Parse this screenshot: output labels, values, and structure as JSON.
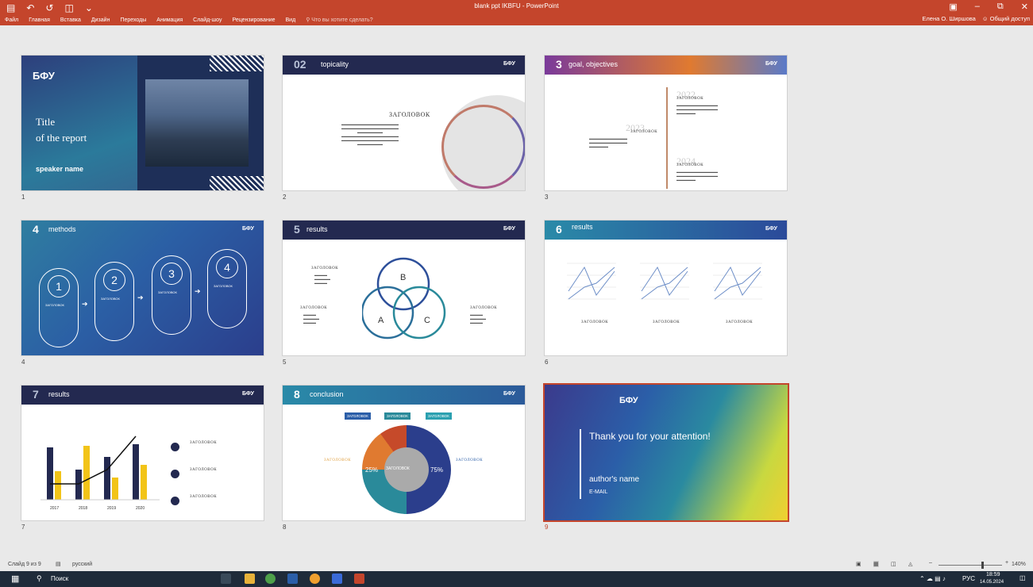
{
  "window": {
    "title": "blank ppt IKBFU - PowerPoint"
  },
  "ribbon": {
    "tabs": [
      "Файл",
      "Главная",
      "Вставка",
      "Дизайн",
      "Переходы",
      "Анимация",
      "Слайд-шоу",
      "Рецензирование",
      "Вид"
    ],
    "tell_me": "Что вы хотите сделать?",
    "user": "Елена О. Ширшова",
    "share": "Общий доступ"
  },
  "slides": [
    {
      "number": "1",
      "logo": "БФУ",
      "title_line1": "Title",
      "title_line2": "of the report",
      "speaker": "speaker name"
    },
    {
      "number": "2",
      "header_num": "02",
      "header_title": "topicality",
      "logo": "БФУ",
      "heading": "ЗАГОЛОВОК"
    },
    {
      "number": "3",
      "header_num": "3",
      "header_title": "goal, objectives",
      "logo": "БФУ",
      "years": [
        "2022",
        "2023",
        "2024"
      ],
      "heading": "ЗАГОЛОВОК"
    },
    {
      "number": "4",
      "header_num": "4",
      "header_title": "methods",
      "logo": "БФУ",
      "steps": [
        "1",
        "2",
        "3",
        "4"
      ],
      "heading": "ЗАГОЛОВОК"
    },
    {
      "number": "5",
      "header_num": "5",
      "header_title": "results",
      "logo": "БФУ",
      "circles": [
        "B",
        "A",
        "C"
      ],
      "heading": "ЗАГОЛОВОК"
    },
    {
      "number": "6",
      "header_num": "6",
      "header_title": "results",
      "logo": "БФУ",
      "heading": "ЗАГОЛОВОК"
    },
    {
      "number": "7",
      "header_num": "7",
      "header_title": "results",
      "logo": "БФУ",
      "heading": "ЗАГОЛОВОК",
      "years": [
        "2017",
        "2018",
        "2019",
        "2020"
      ]
    },
    {
      "number": "8",
      "header_num": "8",
      "header_title": "conclusion",
      "logo": "БФУ",
      "tags": [
        "ЗАГОЛОВОК",
        "ЗАГОЛОВОК",
        "ЗАГОЛОВОК"
      ],
      "center": "ЗАГОЛОВОК",
      "pct_left": "25%",
      "pct_right": "75%",
      "heading": "ЗАГОЛОВОК"
    },
    {
      "number": "9",
      "logo": "БФУ",
      "thanks": "Thank you for your attention!",
      "author": "author's name",
      "email": "E-MAIL"
    }
  ],
  "status": {
    "slide": "Слайд 9 из 9",
    "lang": "русский",
    "zoom": "140%"
  },
  "taskbar": {
    "search": "Поиск",
    "lang": "РУС",
    "time": "18:59",
    "date": "14.05.2024"
  }
}
